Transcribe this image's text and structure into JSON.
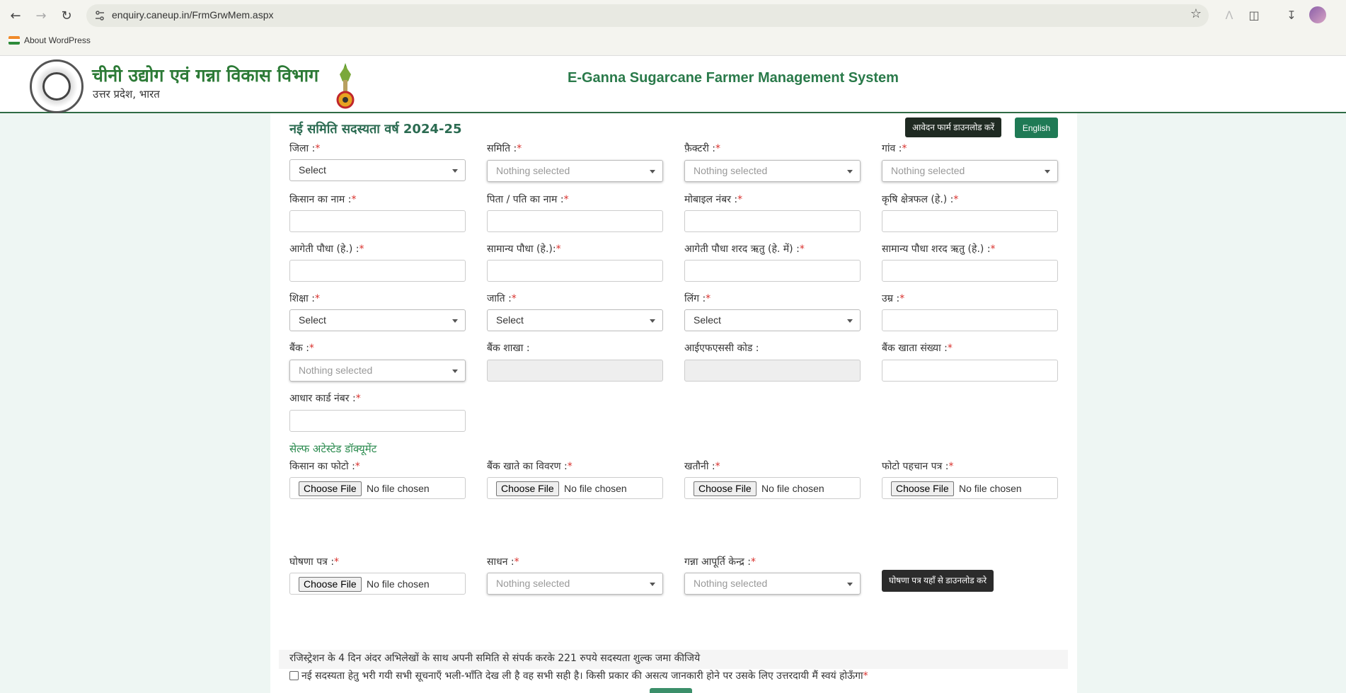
{
  "browser": {
    "url": "enquiry.caneup.in/FrmGrwMem.aspx",
    "bookmark_label": "About WordPress"
  },
  "header": {
    "dept_title": "चीनी उद्योग एवं गन्ना विकास विभाग",
    "dept_subtitle": "उत्तर प्रदेश, भारत",
    "system_title": "E-Ganna Sugarcane Farmer Management System"
  },
  "form": {
    "title": "नई समिति सदस्यता वर्ष 2024-25",
    "download_form_button": "आवेदन फार्म डाउनलोड करें",
    "language_button": "English",
    "required_mark": "*",
    "fields": {
      "district": {
        "label": "जिला :",
        "value": "Select"
      },
      "samiti": {
        "label": "समिति :",
        "value": "Nothing selected"
      },
      "factory": {
        "label": "फ़ैक्टरी :",
        "value": "Nothing selected"
      },
      "village": {
        "label": "गांव :",
        "value": "Nothing selected"
      },
      "farmer_name": {
        "label": "किसान का नाम :"
      },
      "father_name": {
        "label": "पिता / पति का नाम :"
      },
      "mobile": {
        "label": "मोबाइल नंबर :"
      },
      "agri_area": {
        "label": "कृषि क्षेत्रफल (हे.) :"
      },
      "early_plant": {
        "label": "आगेती पौधा (हे.) :"
      },
      "normal_plant": {
        "label": "सामान्य पौधा (हे.):"
      },
      "early_autumn": {
        "label": "आगेती पौधा शरद ऋतु (हे. में) :"
      },
      "normal_autumn": {
        "label": "सामान्य पौधा शरद ऋतु (हे.) :"
      },
      "education": {
        "label": "शिक्षा :",
        "value": "Select"
      },
      "caste": {
        "label": "जाति :",
        "value": "Select"
      },
      "gender": {
        "label": "लिंग :",
        "value": "Select"
      },
      "age": {
        "label": "उम्र :"
      },
      "bank": {
        "label": "बैंक :",
        "value": "Nothing selected"
      },
      "bank_branch": {
        "label": "बैंक शाखा :"
      },
      "ifsc": {
        "label": "आईएफएससी कोड :"
      },
      "account_no": {
        "label": "बैंक खाता संख्या :"
      },
      "aadhaar": {
        "label": "आधार कार्ड नंबर :"
      },
      "farmer_photo": {
        "label": "किसान का फोटो :"
      },
      "bank_details": {
        "label": "बैंक खाते का विवरण :"
      },
      "khatauni": {
        "label": "खतौनी :"
      },
      "photo_id": {
        "label": "फोटो पहचान पत्र :"
      },
      "declaration": {
        "label": "घोषणा पत्र :"
      },
      "sadhan": {
        "label": "साधन :",
        "value": "Nothing selected"
      },
      "supply_center": {
        "label": "गन्ना आपूर्ति केन्द्र :",
        "value": "Nothing selected"
      }
    },
    "file_choose_label": "Choose File",
    "file_no_file": "No file chosen",
    "section_docs": "सेल्फ अटेस्टेड डॉक्यूमेंट",
    "declaration_download_button": "घोषणा पत्र यहाँ से डाउनलोड करे",
    "note": "रजिस्ट्रेशन के 4 दिन अंदर अभिलेखों के साथ अपनी समिति से संपर्क करके 221 रुपये सदस्यता शुल्क जमा कीजिये",
    "consent": "नई सदस्यता हेतु भरी गयी सभी सूचनाएँ भली-भाँति देख ली है वह सभी सही है। किसी प्रकार की असत्य जानकारी होने पर उसके लिए उत्तरदायी मैं स्वयं होऊँगा"
  }
}
